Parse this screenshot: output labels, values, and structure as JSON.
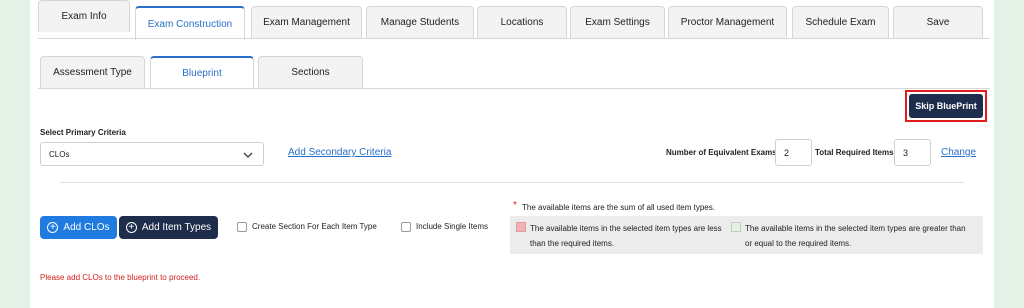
{
  "top_tabs": [
    {
      "label": "Exam Info",
      "active": false
    },
    {
      "label": "Exam Construction",
      "active": true
    },
    {
      "label": "Exam Management",
      "active": false
    },
    {
      "label": "Manage Students",
      "active": false
    },
    {
      "label": "Locations",
      "active": false
    },
    {
      "label": "Exam Settings",
      "active": false
    },
    {
      "label": "Proctor Management",
      "active": false
    },
    {
      "label": "Schedule Exam",
      "active": false
    },
    {
      "label": "Save",
      "active": false
    }
  ],
  "sub_tabs": [
    {
      "label": "Assessment Type",
      "active": false
    },
    {
      "label": "Blueprint",
      "active": true
    },
    {
      "label": "Sections",
      "active": false
    }
  ],
  "skip_blueprint": {
    "label": "Skip BluePrint"
  },
  "criteria": {
    "label": "Select Primary Criteria",
    "selected": "CLOs",
    "add_secondary": "Add Secondary Criteria"
  },
  "exam_counts": {
    "equivalent_label": "Number of Equivalent Exams:",
    "equivalent_value": "2",
    "total_label": "Total Required Items:",
    "total_value": "3",
    "change_label": "Change"
  },
  "actions": {
    "add_clos": "Add CLOs",
    "add_item_types": "Add Item Types",
    "create_section_label": "Create Section For Each Item Type",
    "include_single_label": "Include Single Items"
  },
  "legend": {
    "star": "*",
    "note": "The available items are the sum of all used item types.",
    "less_line1": "The available items in the selected item types are less",
    "less_line2": "than the required items.",
    "greater_line1": "The available items in the selected item types are greater than",
    "greater_line2": "or equal to the required items.",
    "less_color": "#f2b3b5",
    "greater_color": "#e3f1e6"
  },
  "error_message": "Please add CLOs to the blueprint to proceed.",
  "colors": {
    "accent": "#2a6fc9",
    "primary_button": "#1f7be0",
    "dark_button": "#1f2d4d",
    "error": "#d42121",
    "background": "#e3f1e6"
  }
}
